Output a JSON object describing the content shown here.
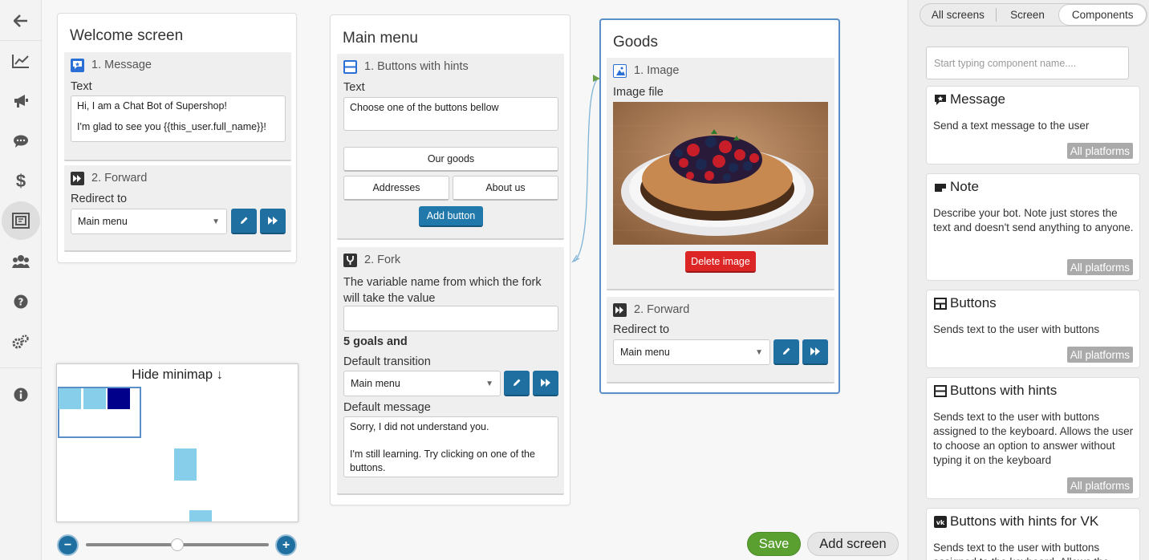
{
  "sidebar": {
    "items": [
      {
        "name": "back-icon"
      },
      {
        "name": "analytics-icon"
      },
      {
        "name": "broadcast-icon"
      },
      {
        "name": "chat-icon"
      },
      {
        "name": "dollar-icon"
      },
      {
        "name": "screens-icon"
      },
      {
        "name": "users-icon"
      },
      {
        "name": "help-icon"
      },
      {
        "name": "settings-icon"
      },
      {
        "name": "info-icon"
      }
    ]
  },
  "screens": {
    "welcome": {
      "title": "Welcome screen",
      "c1_title": "1. Message",
      "c1_label": "Text",
      "c1_text_line1": "Hi, I am a Chat Bot of Supershop!",
      "c1_text_line2": "I'm glad to see you {{this_user.full_name}}!",
      "c2_title": "2. Forward",
      "c2_label": "Redirect to",
      "c2_value": "Main menu"
    },
    "main": {
      "title": "Main menu",
      "c1_title": "1. Buttons with hints",
      "c1_label": "Text",
      "c1_text": "Choose one of the buttons bellow",
      "btn_goods": "Our goods",
      "btn_addresses": "Addresses",
      "btn_about": "About us",
      "add_button": "Add button",
      "c2_title": "2. Fork",
      "c2_label": "The variable name from which the fork will take the value",
      "goals": "5 goals and",
      "default_transition_label": "Default transition",
      "default_transition_value": "Main menu",
      "default_message_label": "Default message",
      "default_message_line1": "Sorry, I did not understand you.",
      "default_message_line2": "I'm still learning. Try clicking on one of the buttons."
    },
    "goods": {
      "title": "Goods",
      "c1_title": "1. Image",
      "c1_label": "Image file",
      "delete_image": "Delete image",
      "c2_title": "2. Forward",
      "c2_label": "Redirect to",
      "c2_value": "Main menu"
    }
  },
  "minimap": {
    "title": "Hide minimap ↓"
  },
  "footer": {
    "save": "Save",
    "add_screen": "Add screen",
    "zoom_out": "−",
    "zoom_in": "+",
    "zoom_level": 0.5
  },
  "right_panel": {
    "tabs": [
      "All screens",
      "Screen",
      "Components"
    ],
    "active_tab": "Components",
    "search_placeholder": "Start typing component name....",
    "components": [
      {
        "title": "Message",
        "desc": "Send a text message to the user",
        "badge": "All platforms",
        "icon": "message-icon"
      },
      {
        "title": "Note",
        "desc": "Describe your bot. Note just stores the text and doesn't send anything to anyone.",
        "badge": "All platforms",
        "icon": "note-icon"
      },
      {
        "title": "Buttons",
        "desc": "Sends text to the user with buttons",
        "badge": "All platforms",
        "icon": "buttons-icon"
      },
      {
        "title": "Buttons with hints",
        "desc": "Sends text to the user with buttons assigned to the keyboard. Allows the user to choose an option to answer without typing it on the keyboard",
        "badge": "All platforms",
        "icon": "buttons-hints-icon"
      },
      {
        "title": "Buttons with hints for VK",
        "desc": "Sends text to the user with buttons assigned to the keyboard. Allows the",
        "badge": "",
        "icon": "vk-icon"
      }
    ]
  },
  "colors": {
    "accent": "#1f6fa0",
    "save": "#5aa031",
    "delete": "#dc2626",
    "selected_border": "#5b8fc7"
  }
}
